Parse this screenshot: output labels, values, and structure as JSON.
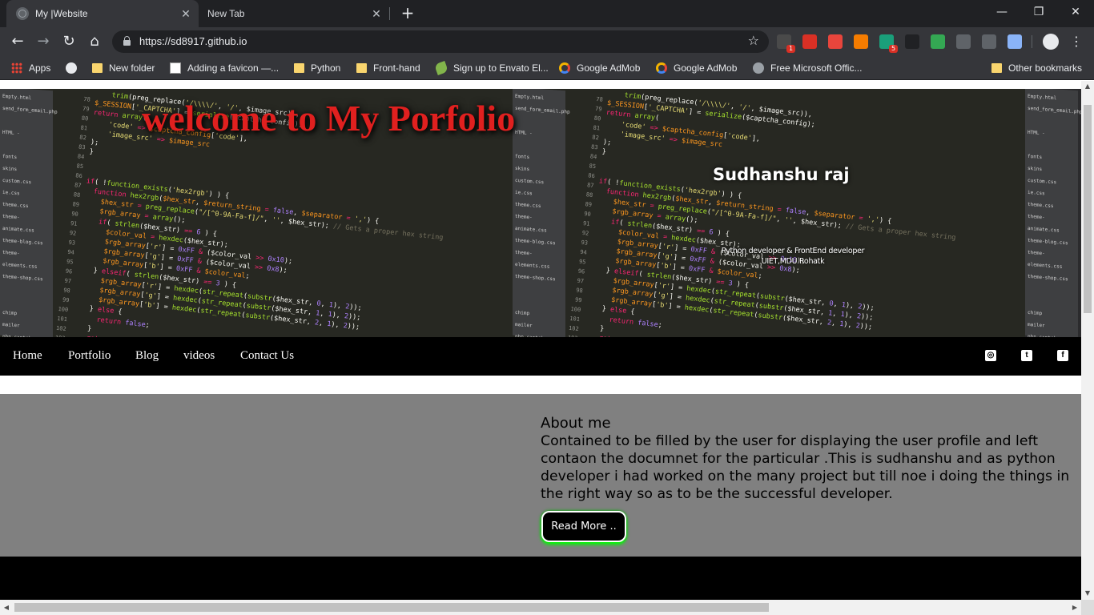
{
  "browser": {
    "tabs": [
      {
        "title": "My |Website",
        "active": true
      },
      {
        "title": "New Tab",
        "active": false
      }
    ],
    "url": "https://sd8917.github.io",
    "extensions": [
      {
        "name": "ext-1",
        "color": "#4a4a4a",
        "badge": "1"
      },
      {
        "name": "ext-2",
        "color": "#d93025",
        "badge": ""
      },
      {
        "name": "ext-3",
        "color": "#e8453c",
        "badge": ""
      },
      {
        "name": "ext-4",
        "color": "#f57c00",
        "badge": ""
      },
      {
        "name": "ext-5",
        "color": "#1a9f7a",
        "badge": "5"
      },
      {
        "name": "ext-6",
        "color": "#202124",
        "badge": ""
      },
      {
        "name": "ext-7",
        "color": "#34a853",
        "badge": ""
      },
      {
        "name": "ext-8",
        "color": "#5f6368",
        "badge": ""
      },
      {
        "name": "ext-9",
        "color": "#5f6368",
        "badge": ""
      },
      {
        "name": "ext-10",
        "color": "#8ab4f8",
        "badge": ""
      }
    ],
    "bookmarks": [
      {
        "label": "Apps",
        "icon": "apps-icon"
      },
      {
        "label": "",
        "icon": "globe-icon"
      },
      {
        "label": "New folder",
        "icon": "folder-icon"
      },
      {
        "label": "Adding a favicon —...",
        "icon": "page-icon"
      },
      {
        "label": "Python",
        "icon": "folder-icon"
      },
      {
        "label": "Front-hand",
        "icon": "folder-icon"
      },
      {
        "label": "Sign up to Envato El...",
        "icon": "leaf-icon"
      },
      {
        "label": "Google AdMob",
        "icon": "admob-icon"
      },
      {
        "label": "Google AdMob",
        "icon": "admob-icon"
      },
      {
        "label": "Free Microsoft Offic...",
        "icon": "microsoft-icon"
      }
    ],
    "other_bookmarks": "Other bookmarks"
  },
  "hero": {
    "title": "welcome to My Porfolio",
    "name": "Sudhanshu raj",
    "subtitle_line1": "Python developer & FrontEnd developer",
    "subtitle_line2": "UIET,MDU Rohatk"
  },
  "nav": {
    "links": [
      "Home",
      "Portfolio",
      "Blog",
      "videos",
      "Contact Us"
    ],
    "social": [
      "github-icon",
      "twitter-icon",
      "facebook-icon"
    ]
  },
  "about": {
    "heading": "About me",
    "text": "Contained to be filled by the user for displaying the user profile and left contaon the documnet for the particular .This is sudhanshu and as python developer i had worked on the many project but till noe i doing the things in the right way so as to be the successful developer.",
    "button": "Read More .."
  },
  "code_background": {
    "files": [
      "Empty.html",
      "send_form_email.php",
      "",
      "HTML -",
      "",
      "fonts",
      "skins",
      "custom.css",
      "ie.css",
      "theme.css",
      "theme-animate.css",
      "theme-blog.css",
      "theme-elements.css",
      "theme-shop.css",
      "",
      "",
      "chimp",
      "mailer",
      "php-captcha"
    ],
    "line_numbers": [
      "78",
      "79",
      "80",
      "81",
      "82",
      "83",
      "84",
      "85",
      "86",
      "87",
      "88",
      "89",
      "90",
      "91",
      "92",
      "93",
      "94",
      "95",
      "96",
      "97",
      "98",
      "99",
      "100",
      "101",
      "102",
      "103",
      "104",
      "105"
    ]
  }
}
